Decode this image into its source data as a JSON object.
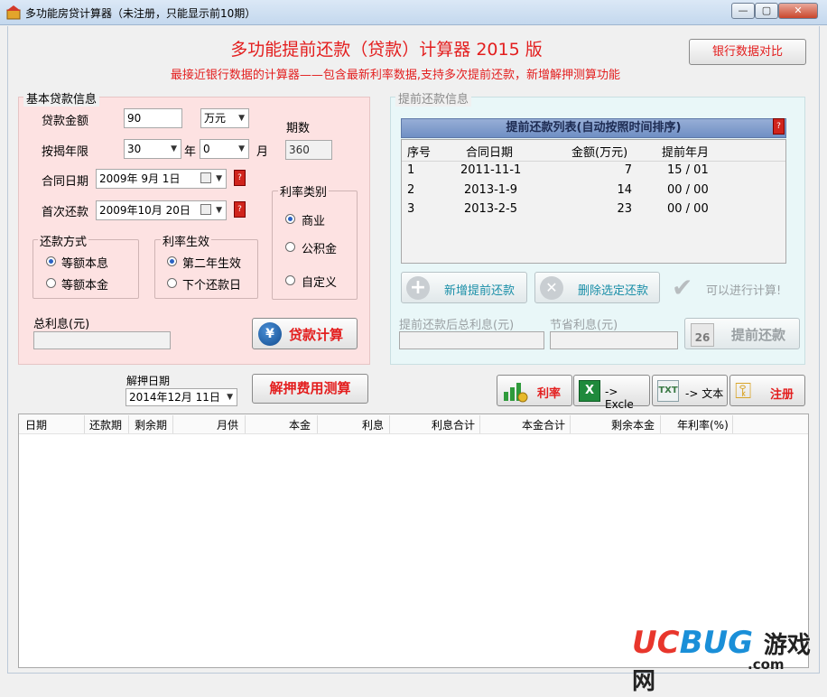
{
  "window": {
    "title": "多功能房贷计算器（未注册，只能显示前10期）",
    "controls": {
      "minimize": "—",
      "maximize": "▢",
      "close": "✕"
    }
  },
  "header": {
    "main_title": "多功能提前还款（贷款）计算器 2015 版",
    "subtitle": "最接近银行数据的计算器——包含最新利率数据,支持多次提前还款，新增解押测算功能",
    "bank_compare_label": "银行数据对比"
  },
  "basic_info": {
    "legend": "基本贷款信息",
    "amount_label": "贷款金额",
    "amount_value": "90",
    "amount_unit": "万元",
    "term_label": "按揭年限",
    "years_value": "30",
    "year_char": "年",
    "months_value": "0",
    "month_char": "月",
    "periods_label": "期数",
    "periods_value": "360",
    "contract_date_label": "合同日期",
    "contract_date_value": "2009年 9月  1日",
    "first_repay_label": "首次还款",
    "first_repay_value": "2009年10月 20日",
    "repay_method": {
      "legend": "还款方式",
      "options": [
        "等额本息",
        "等额本金"
      ],
      "selected": 0
    },
    "rate_effect": {
      "legend": "利率生效",
      "options": [
        "第二年生效",
        "下个还款日"
      ],
      "selected": 0
    },
    "rate_type": {
      "legend": "利率类别",
      "options": [
        "商业",
        "公积金",
        "自定义"
      ],
      "selected": 0
    },
    "total_interest_label": "总利息(元)",
    "total_interest_value": "",
    "calc_button": "贷款计算",
    "calc_icon": "yen-icon"
  },
  "prepay_info": {
    "legend": "提前还款信息",
    "list_title": "提前还款列表(自动按照时间排序)",
    "columns": [
      "序号",
      "合同日期",
      "金额(万元)",
      "提前年月"
    ],
    "rows": [
      {
        "no": "1",
        "date": "2011-11-1",
        "amount": "7",
        "ym": "15 / 01"
      },
      {
        "no": "2",
        "date": "2013-1-9",
        "amount": "14",
        "ym": "00 / 00"
      },
      {
        "no": "3",
        "date": "2013-2-5",
        "amount": "23",
        "ym": "00 / 00"
      }
    ],
    "add_button": "新增提前还款",
    "delete_button": "删除选定还款",
    "ready_text": "可以进行计算!",
    "after_interest_label": "提前还款后总利息(元)",
    "saved_interest_label": "节省利息(元)",
    "prepay_button": "提前还款",
    "calendar_day": "26"
  },
  "release": {
    "date_label": "解押日期",
    "date_value": "2014年12月 11日",
    "calc_button": "解押费用测算"
  },
  "toolbar": {
    "rate_label": "利率",
    "excel_label": "-> Excle",
    "text_label": "-> 文本",
    "register_label": "注册"
  },
  "grid": {
    "columns": [
      "日期",
      "还款期",
      "剩余期",
      "月供",
      "本金",
      "利息",
      "利息合计",
      "本金合计",
      "剩余本金",
      "年利率(%)"
    ]
  },
  "watermark": {
    "brand": "UCBUG",
    "cn": "游戏网",
    "domain": ".com",
    "colors": {
      "u": "#e8362c",
      "c": "#e8362c",
      "bug": "#1a8fd8",
      "cn": "#222222"
    }
  }
}
